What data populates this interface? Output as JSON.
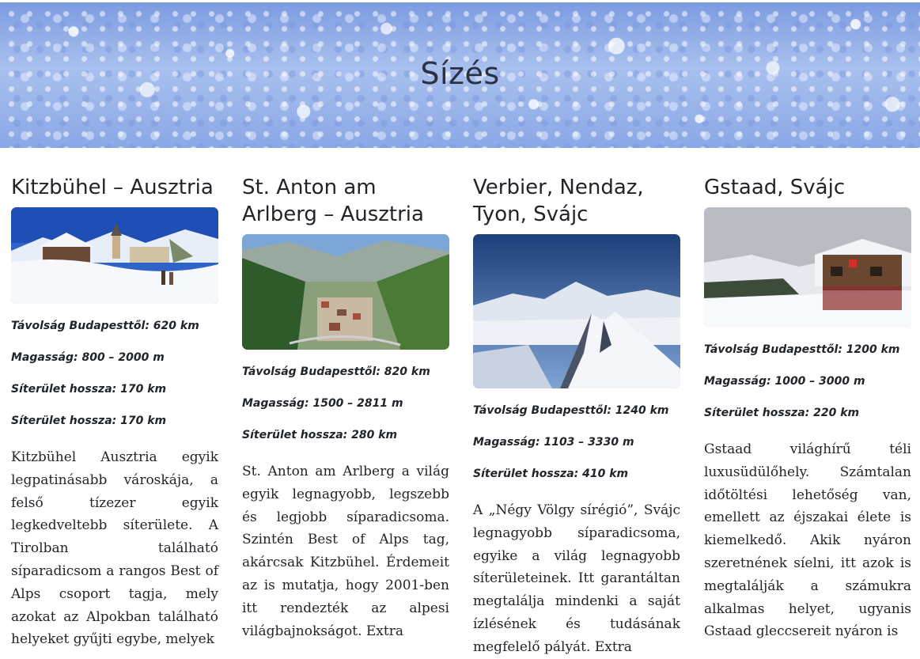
{
  "header": {
    "title": "Sízés"
  },
  "resorts": [
    {
      "title": "Kitzbühel – Ausztria",
      "stats": [
        "Távolság Budapesttől: 620 km",
        "Magasság: 800 – 2000 m",
        "Síterület hossza: 170 km",
        "Síterület hossza: 170 km"
      ],
      "description": "Kitzbühel Ausztria egyik legpatinásabb városkája, a felső tízezer egyik legkedveltebb síterülete. A Tirolban található síparadicsom a rangos Best of Alps csoport tagja, mely azokat az Alpokban található helyeket gyűjti egybe, melyek"
    },
    {
      "title": "St. Anton am Arlberg – Ausztria",
      "stats": [
        "Távolság Budapesttől: 820 km",
        "Magasság: 1500 – 2811 m",
        "Síterület hossza: 280 km"
      ],
      "description": "St. Anton am Arlberg a világ egyik legnagyobb, legszebb és legjobb síparadicsoma. Szintén Best of Alps tag, akárcsak Kitzbühel. Érdemeit az is mutatja, hogy 2001-ben itt rendezték az alpesi világbajnokságot. Extra"
    },
    {
      "title": "Verbier, Nendaz, Tyon, Svájc",
      "stats": [
        "Távolság Budapesttől: 1240 km",
        "Magasság: 1103 – 3330 m",
        "Síterület hossza: 410 km"
      ],
      "description": "A „Négy Völgy sírégió”, Svájc legnagyobb síparadicsoma, egyike a világ legnagyobb síterületeinek. Itt garantáltan megtalálja mindenki a saját ízlésének és tudásának megfelelő pályát. Extra"
    },
    {
      "title": "Gstaad, Svájc",
      "stats": [
        "Távolság Budapesttől: 1200 km",
        "Magasság: 1000 – 3000 m",
        "Síterület hossza: 220 km"
      ],
      "description": "Gstaad világhírű téli luxusüdülőhely. Számtalan időtöltési lehetőség van, emellett az éjszakai élete is kiemelkedő. Akik nyáron szeretnének síelni, itt azok is megtalálják a számukra alkalmas helyet, ugyanis Gstaad gleccsereit nyáron is"
    }
  ]
}
